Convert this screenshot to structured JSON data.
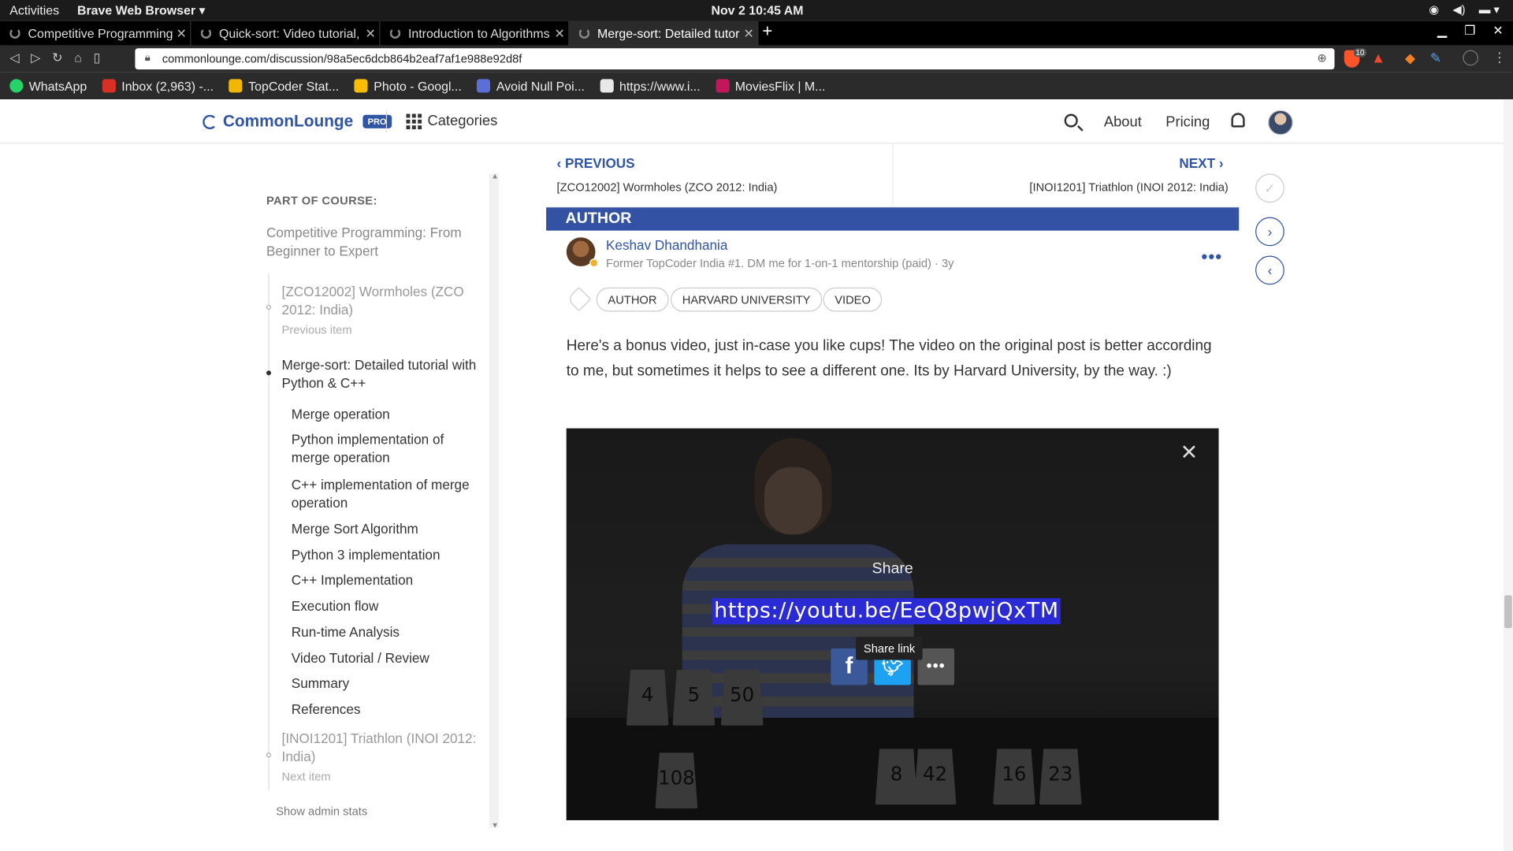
{
  "os": {
    "activities": "Activities",
    "app_name": "Brave Web Browser ▾",
    "clock": "Nov 2  10:45 AM"
  },
  "tabs": [
    {
      "label": "Competitive Programming"
    },
    {
      "label": "Quick-sort: Video tutorial,"
    },
    {
      "label": "Introduction to Algorithms"
    },
    {
      "label": "Merge-sort: Detailed tutori"
    }
  ],
  "url": "commonlounge.com/discussion/98a5ec6dcb864b2eaf7af1e988e92d8f",
  "shield_count": "10",
  "bookmarks": [
    {
      "label": "WhatsApp",
      "color": "#25d366"
    },
    {
      "label": "Inbox (2,963) -...",
      "color": "#d93025"
    },
    {
      "label": "TopCoder Stat...",
      "color": "#f2b705"
    },
    {
      "label": "Photo - Googl...",
      "color": "#fbbc04"
    },
    {
      "label": "Avoid Null Poi...",
      "color": "#5b6fd8"
    },
    {
      "label": "https://www.i...",
      "color": "#e8e8e8"
    },
    {
      "label": "MoviesFlix | M...",
      "color": "#c2185b"
    }
  ],
  "header": {
    "logo_text": "CommonLounge",
    "pro_badge": "PRO",
    "categories": "Categories",
    "about": "About",
    "pricing": "Pricing"
  },
  "sidebar": {
    "part_label": "PART OF COURSE:",
    "course_title": "Competitive Programming: From Beginner to Expert",
    "prev_item": {
      "title": "[ZCO12002] Wormholes (ZCO 2012: India)",
      "sub": "Previous item"
    },
    "current_item": {
      "title": "Merge-sort: Detailed tutorial with Python & C++"
    },
    "sub_items": [
      "Merge operation",
      "Python implementation of merge operation",
      "C++ implementation of merge operation",
      "Merge Sort Algorithm",
      "Python 3 implementation",
      "C++ Implementation",
      "Execution flow",
      "Run-time Analysis",
      "Video Tutorial / Review",
      "Summary",
      "References"
    ],
    "next_item": {
      "title": "[INOI1201] Triathlon (INOI 2012: India)",
      "sub": "Next item"
    },
    "admin_stats": "Show admin stats"
  },
  "nav": {
    "prev_label": "PREVIOUS",
    "prev_title": "[ZCO12002] Wormholes (ZCO 2012: India)",
    "next_label": "NEXT",
    "next_title": "[INOI1201] Triathlon (INOI 2012: India)"
  },
  "author_banner": "AUTHOR",
  "post": {
    "author_name": "Keshav Dhandhania",
    "author_meta": "Former TopCoder India #1. DM me for 1-on-1 mentorship (paid) · 3y",
    "tags": [
      "AUTHOR",
      "HARVARD UNIVERSITY",
      "VIDEO"
    ],
    "body": "Here's a bonus video, just in-case you like cups! The video on the original post is better according to me, but sometimes it helps to see a different one. Its by Harvard University, by the way. :)"
  },
  "video": {
    "share_title": "Share",
    "share_url": "https://youtu.be/EeQ8pwjQxTM",
    "share_tooltip": "Share link",
    "cup_labels": [
      "4",
      "5",
      "50",
      "108",
      "8",
      "42",
      "16",
      "23"
    ]
  },
  "colors": {
    "brand": "#2f55a4",
    "author_banner": "#3352a3"
  }
}
